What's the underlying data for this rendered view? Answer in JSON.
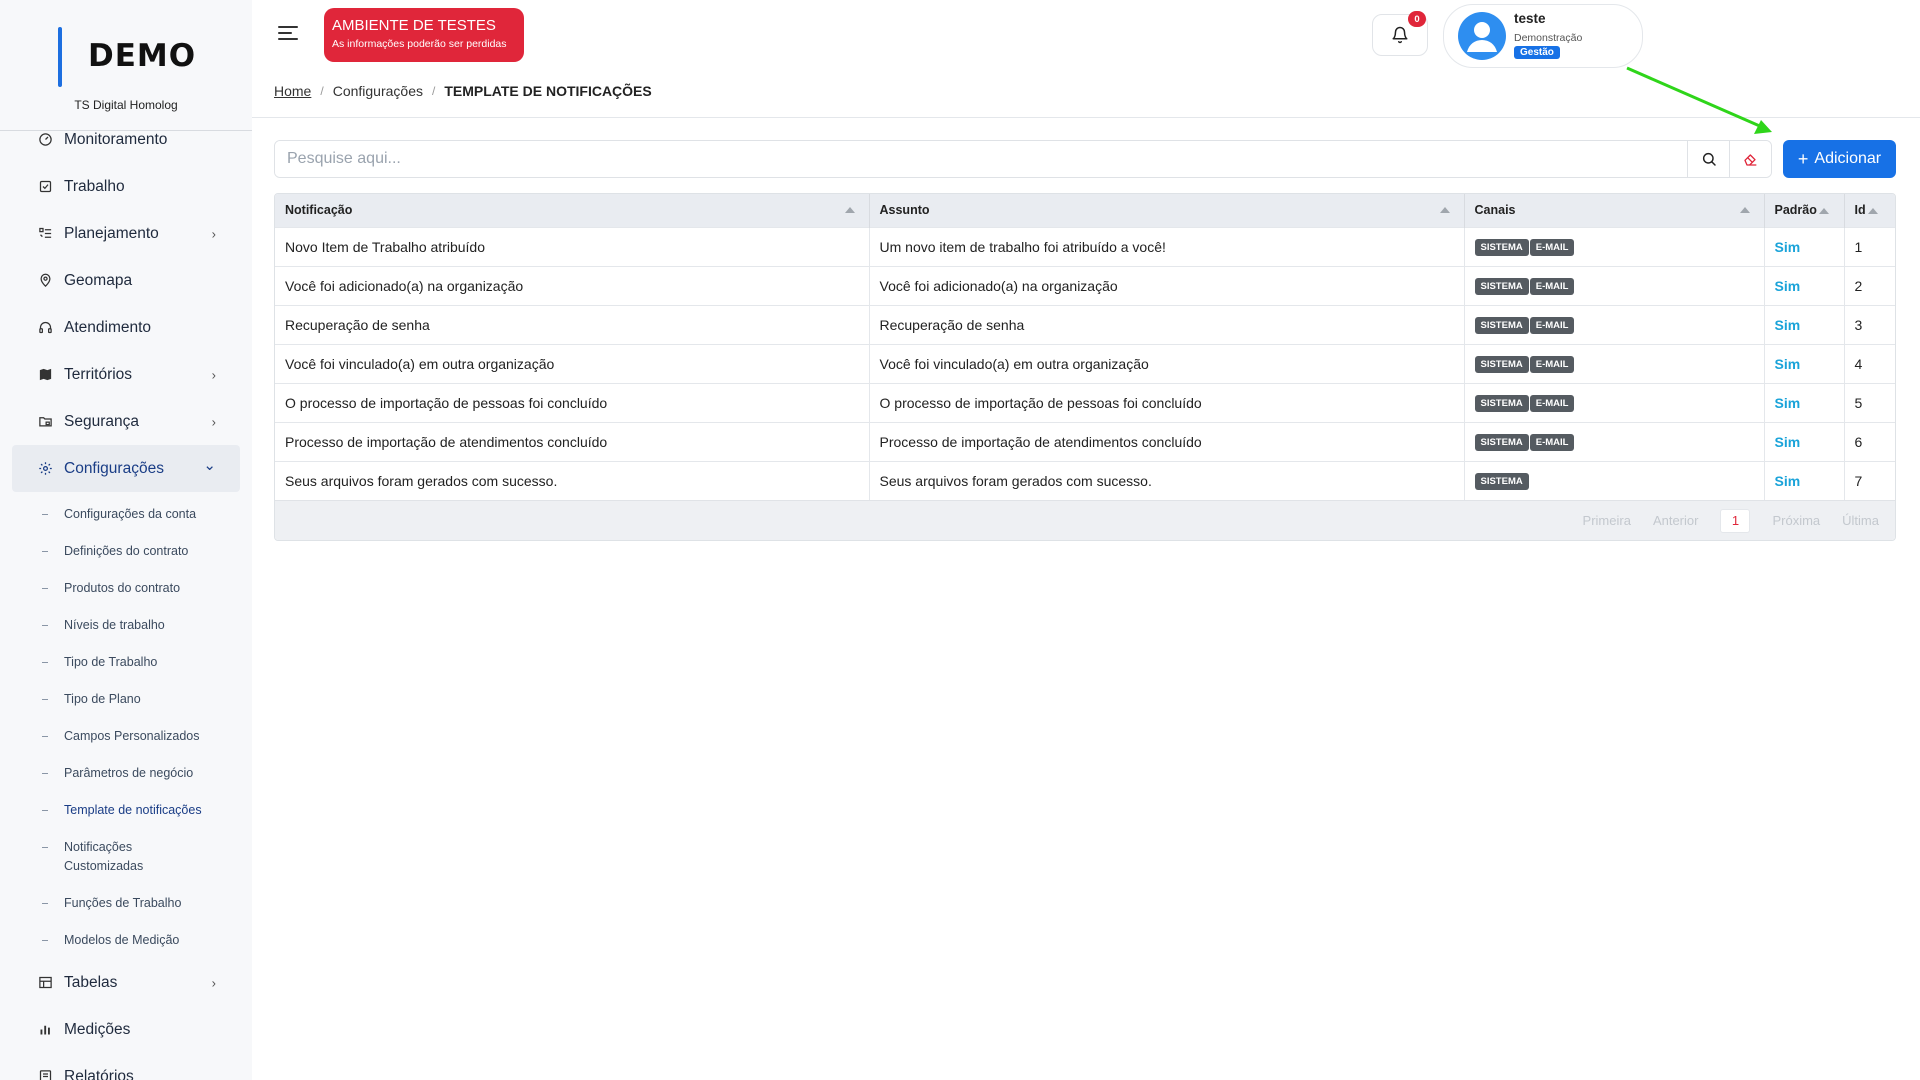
{
  "logo": {
    "title": "DEMO",
    "subtitle": "TS Digital Homolog"
  },
  "sidebar": {
    "items": [
      {
        "label": "Monitoramento",
        "icon": "gauge-icon"
      },
      {
        "label": "Trabalho",
        "icon": "checkbox-icon"
      },
      {
        "label": "Planejamento",
        "icon": "list-icon",
        "chevron": true
      },
      {
        "label": "Geomapa",
        "icon": "location-pin-icon"
      },
      {
        "label": "Atendimento",
        "icon": "headset-icon"
      },
      {
        "label": "Territórios",
        "icon": "map-icon",
        "chevron": true
      },
      {
        "label": "Segurança",
        "icon": "folder-lock-icon",
        "chevron": true
      },
      {
        "label": "Configurações",
        "icon": "gear-icon",
        "chevron": true,
        "active": true
      }
    ],
    "submenu": [
      "Configurações da conta",
      "Definições do contrato",
      "Produtos do contrato",
      "Níveis de trabalho",
      "Tipo de Trabalho",
      "Tipo de Plano",
      "Campos Personalizados",
      "Parâmetros de negócio",
      "Template de notificações",
      "Notificações Customizadas",
      "Funções de Trabalho",
      "Modelos de Medição"
    ],
    "bottom_items": [
      {
        "label": "Tabelas",
        "icon": "table-icon",
        "chevron": true
      },
      {
        "label": "Medições",
        "icon": "bar-chart-icon"
      },
      {
        "label": "Relatórios",
        "icon": "report-icon"
      }
    ]
  },
  "header": {
    "env_title": "AMBIENTE DE TESTES",
    "env_subtitle": "As informações poderão ser perdidas",
    "notification_count": "0",
    "user_name": "teste",
    "user_role": "Demonstração",
    "user_tag": "Gestão"
  },
  "breadcrumb": {
    "home": "Home",
    "section": "Configurações",
    "current": "TEMPLATE DE NOTIFICAÇÕES"
  },
  "search": {
    "placeholder": "Pesquise aqui..."
  },
  "add_button": {
    "label": "Adicionar"
  },
  "table": {
    "columns": [
      "Notificação",
      "Assunto",
      "Canais",
      "Padrão",
      "Id"
    ],
    "rows": [
      {
        "notificacao": "Novo Item de Trabalho atribuído",
        "assunto": "Um novo item de trabalho foi atribuído a você!",
        "canais": [
          "SISTEMA",
          "E-MAIL"
        ],
        "padrao": "Sim",
        "id": "1"
      },
      {
        "notificacao": "Você foi adicionado(a) na organização",
        "assunto": "Você foi adicionado(a) na organização",
        "canais": [
          "SISTEMA",
          "E-MAIL"
        ],
        "padrao": "Sim",
        "id": "2"
      },
      {
        "notificacao": "Recuperação de senha",
        "assunto": "Recuperação de senha",
        "canais": [
          "SISTEMA",
          "E-MAIL"
        ],
        "padrao": "Sim",
        "id": "3"
      },
      {
        "notificacao": "Você foi vinculado(a) em outra organização",
        "assunto": "Você foi vinculado(a) em outra organização",
        "canais": [
          "SISTEMA",
          "E-MAIL"
        ],
        "padrao": "Sim",
        "id": "4"
      },
      {
        "notificacao": "O processo de importação de pessoas foi concluído",
        "assunto": "O processo de importação de pessoas foi concluído",
        "canais": [
          "SISTEMA",
          "E-MAIL"
        ],
        "padrao": "Sim",
        "id": "5"
      },
      {
        "notificacao": "Processo de importação de atendimentos concluído",
        "assunto": "Processo de importação de atendimentos concluído",
        "canais": [
          "SISTEMA",
          "E-MAIL"
        ],
        "padrao": "Sim",
        "id": "6"
      },
      {
        "notificacao": "Seus arquivos foram gerados com sucesso.",
        "assunto": "Seus arquivos foram gerados com sucesso.",
        "canais": [
          "SISTEMA"
        ],
        "padrao": "Sim",
        "id": "7"
      }
    ]
  },
  "pagination": {
    "first": "Primeira",
    "prev": "Anterior",
    "page": "1",
    "next": "Próxima",
    "last": "Última"
  },
  "colors": {
    "primary": "#1771e6",
    "danger": "#e0263a",
    "link": "#1aa3d9",
    "arrow": "#2fd51a"
  }
}
